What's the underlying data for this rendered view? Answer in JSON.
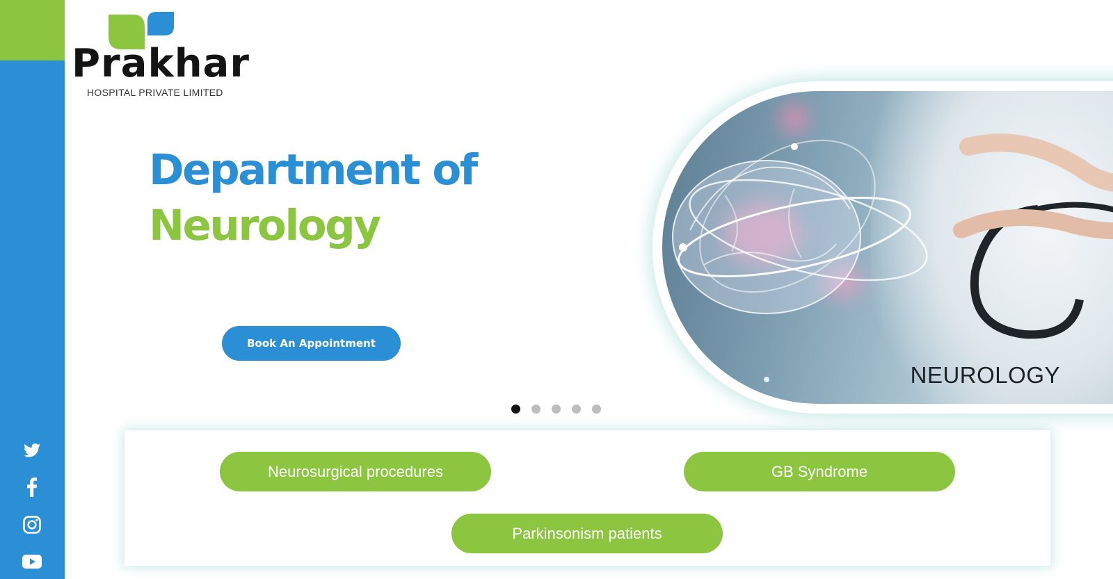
{
  "brand": {
    "name": "Prakhar",
    "subtitle": "HOSPITAL PRIVATE LIMITED"
  },
  "hero": {
    "title_line1": "Department of",
    "title_line2": "Neurology",
    "cta_label": "Book An Appointment",
    "image_caption": "NEUROLOGY"
  },
  "carousel": {
    "slide_count": 5,
    "active_index": 0
  },
  "services": [
    "Neurosurgical procedures",
    "GB Syndrome",
    "Parkinsonism patients"
  ],
  "social": [
    "twitter-icon",
    "facebook-icon",
    "instagram-icon",
    "youtube-icon"
  ],
  "colors": {
    "blue": "#2a8fd4",
    "green": "#8cc540"
  }
}
